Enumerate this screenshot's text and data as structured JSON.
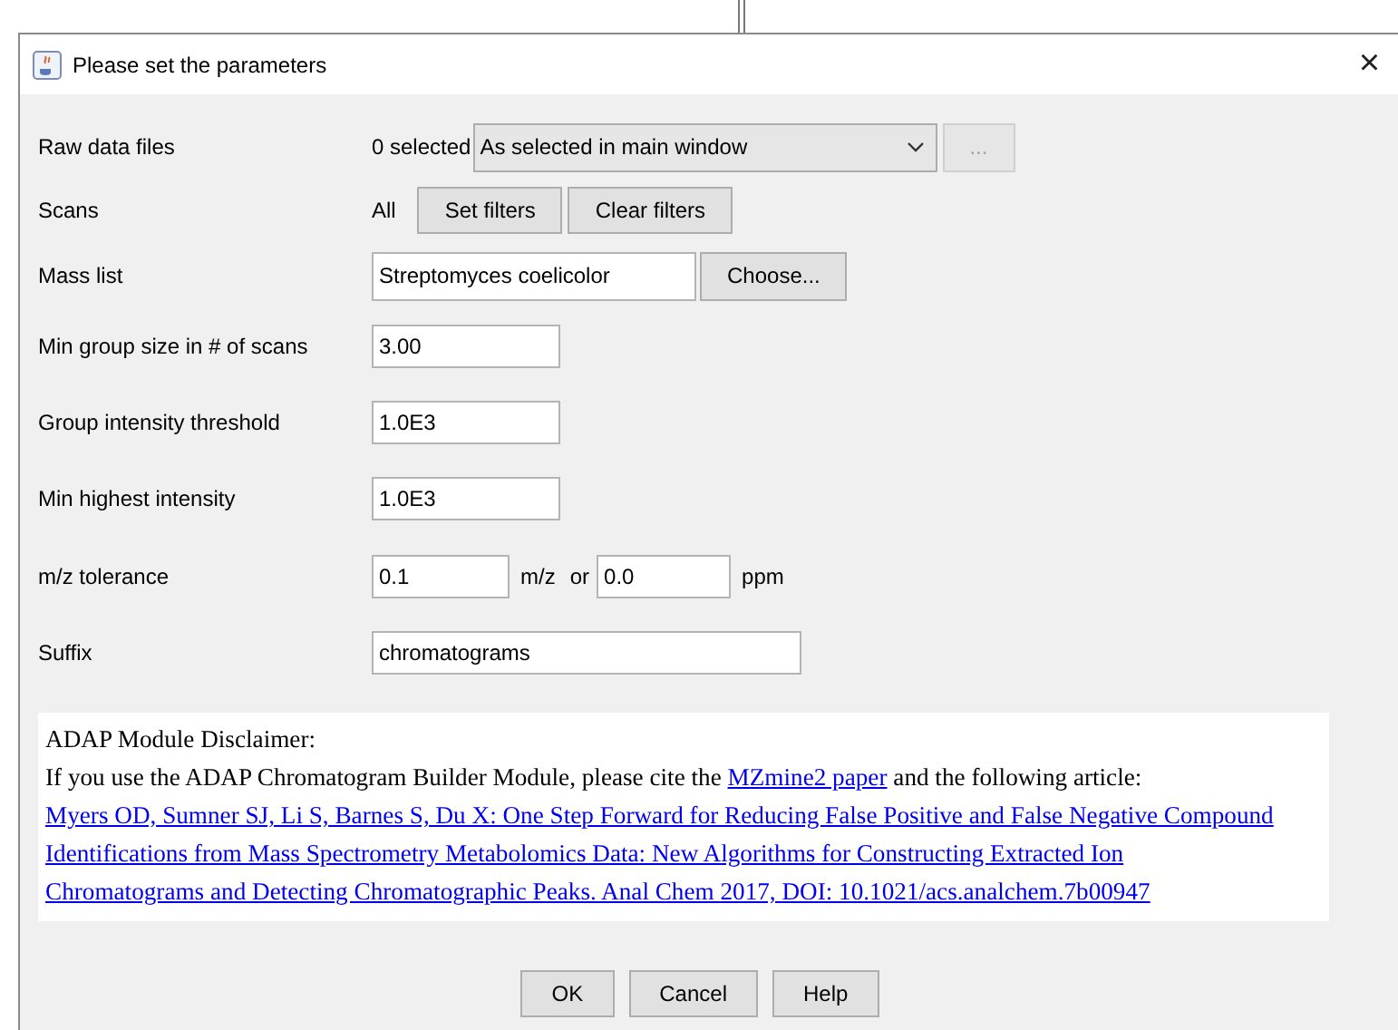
{
  "window": {
    "title": "Please set the parameters",
    "close": "×"
  },
  "parameters": [
    {
      "kind": "files",
      "label": "Raw data files",
      "count": "0 selected",
      "dropdown": {
        "value": "As selected in main window"
      },
      "more_button": {
        "label": "...",
        "disabled": true
      }
    },
    {
      "kind": "scans",
      "label": "Scans",
      "value": "All",
      "buttons": [
        "Set filters",
        "Clear filters"
      ]
    },
    {
      "kind": "choose",
      "label": "Mass list",
      "value": "Streptomyces coelicolor",
      "button": "Choose..."
    },
    {
      "kind": "text",
      "label": "Min group size in # of scans",
      "value": "3.00"
    },
    {
      "kind": "text",
      "label": "Group intensity threshold",
      "value": "1.0E3"
    },
    {
      "kind": "text",
      "label": "Min highest intensity",
      "value": "1.0E3"
    },
    {
      "kind": "tolerance",
      "label": "m/z tolerance",
      "mz": "0.1",
      "mz_unit": "m/z",
      "or": "or",
      "ppm": "0.0",
      "ppm_unit": "ppm"
    },
    {
      "kind": "wide",
      "label": "Suffix",
      "value": "chromatograms"
    }
  ],
  "disclaimer": {
    "title": "ADAP Module Disclaimer:",
    "before": "If you use the ADAP Chromatogram Builder Module, please cite the",
    "link": "MZmine2 paper",
    "after": "and the following article:",
    "article": "Myers OD, Sumner SJ, Li S, Barnes S, Du X: One Step Forward for Reducing False Positive and False Negative Compound Identifications from Mass Spectrometry Metabolomics Data: New Algorithms for Constructing Extracted Ion Chromatograms and Detecting Chromatographic Peaks. Anal Chem 2017, DOI: 10.1021/acs.analchem.7b00947"
  },
  "buttons": [
    "OK",
    "Cancel",
    "Help"
  ]
}
